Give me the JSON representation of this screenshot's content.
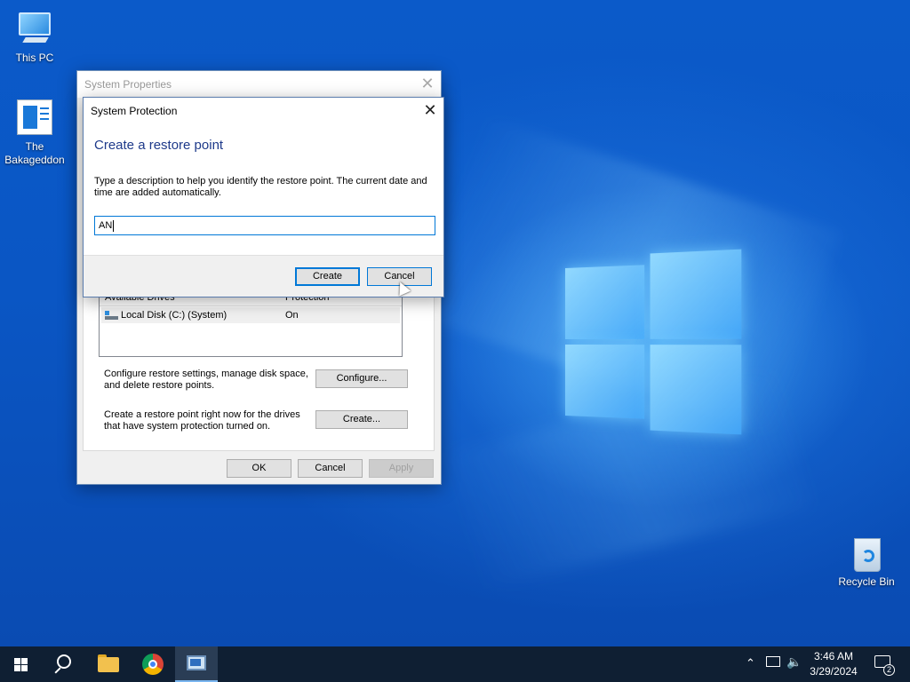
{
  "desktop": {
    "icons": [
      {
        "label": "This PC",
        "icon": "computer-icon"
      },
      {
        "label": "The Bakageddon",
        "icon": "document-icon"
      },
      {
        "label": "Recycle Bin",
        "icon": "recycle-bin-icon"
      }
    ]
  },
  "system_properties": {
    "title": "System Properties",
    "drives_header": {
      "col1": "Available Drives",
      "col2": "Protection"
    },
    "drives": [
      {
        "name": "Local Disk (C:) (System)",
        "protection": "On"
      }
    ],
    "configure_text": "Configure restore settings, manage disk space, and delete restore points.",
    "configure_button": "Configure...",
    "create_text": "Create a restore point right now for the drives that have system protection turned on.",
    "create_button": "Create...",
    "ok_button": "OK",
    "cancel_button": "Cancel",
    "apply_button": "Apply"
  },
  "system_protection": {
    "title": "System Protection",
    "heading": "Create a restore point",
    "description": "Type a description to help you identify the restore point. The current date and time are added automatically.",
    "input_value": "AN",
    "create_button": "Create",
    "cancel_button": "Cancel"
  },
  "taskbar": {
    "apps": [
      "start-icon",
      "search-icon",
      "file-explorer-icon",
      "chrome-icon",
      "system-properties-icon"
    ],
    "time": "3:46 AM",
    "date": "3/29/2024",
    "notification_count": "2"
  },
  "colors": {
    "accent": "#0078d7",
    "heading": "#1e3a8a",
    "taskbar": "#0f1f33",
    "wallpaper": "#0a56c4"
  }
}
